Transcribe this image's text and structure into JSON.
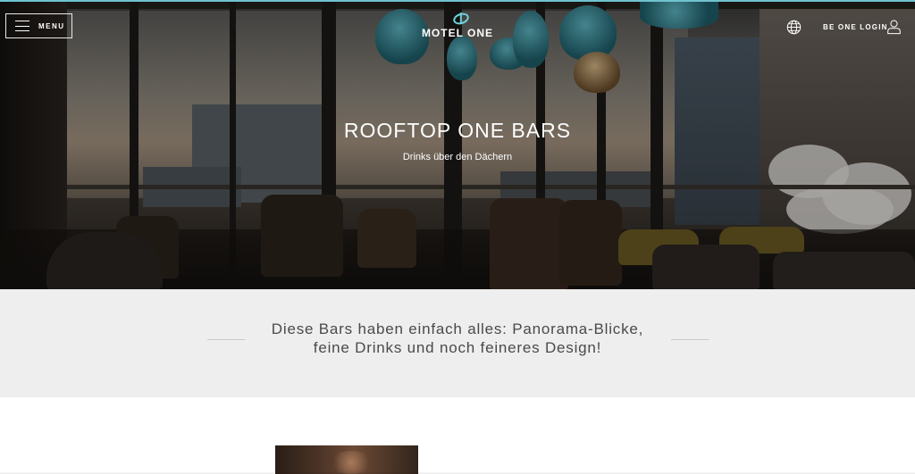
{
  "header": {
    "menu_label": "MENU",
    "logo_text": "MOTEL ONE",
    "login_label": "BE ONE LOGIN",
    "icons": [
      "hamburger-icon",
      "globe-icon",
      "user-icon"
    ]
  },
  "hero": {
    "title": "ROOFTOP ONE BARS",
    "subtitle": "Drinks über den Dächern"
  },
  "intro": {
    "line1": "Diese Bars haben einfach alles: Panorama-Blicke,",
    "line2": "feine Drinks und noch feineres Design!"
  },
  "colors": {
    "accent": "#6fc3cf",
    "intro_background": "#eeeeee",
    "text": "#4a4a4a"
  }
}
